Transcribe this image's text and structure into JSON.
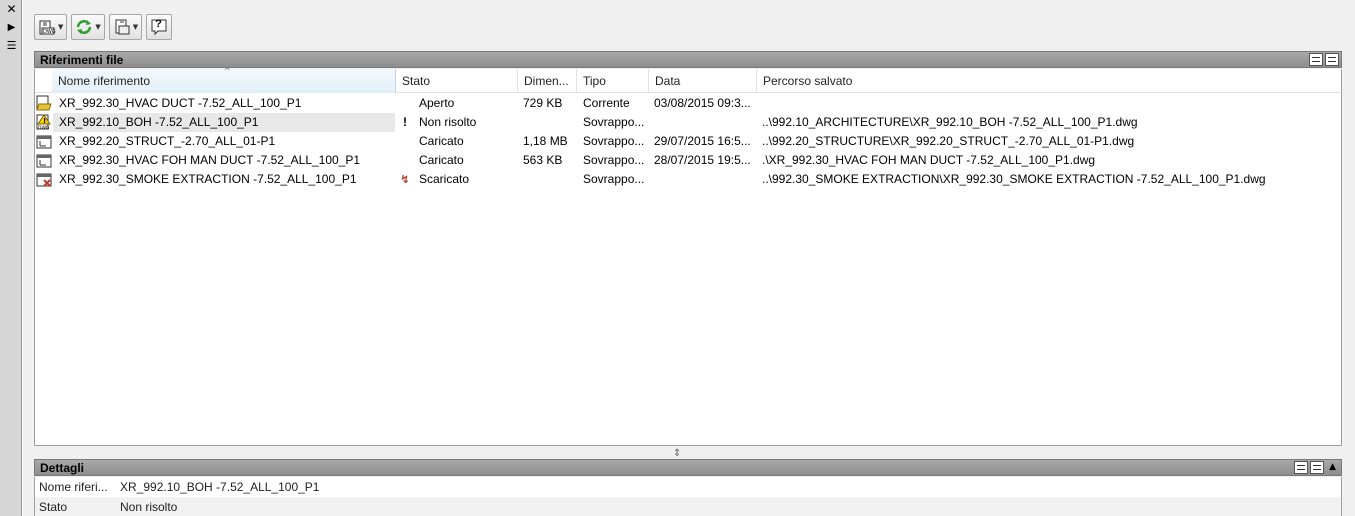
{
  "sidebar": {
    "close_glyph": "✕",
    "autohide_glyph": "▶",
    "properties_glyph": "☰"
  },
  "toolbar": {
    "buttons": [
      {
        "icon": "attach-dwg-icon",
        "has_dropdown": true
      },
      {
        "icon": "refresh-icon",
        "has_dropdown": true
      },
      {
        "icon": "change-path-icon",
        "has_dropdown": true
      },
      {
        "icon": "help-icon",
        "has_dropdown": false
      }
    ],
    "help_glyph": "?"
  },
  "file_references": {
    "title": "Riferimenti file",
    "columns": [
      "Nome riferimento",
      "Stato",
      "Dimen...",
      "Tipo",
      "Data",
      "Percorso salvato"
    ],
    "rows": [
      {
        "icon": "dwg-open-icon",
        "name": "XR_992.30_HVAC DUCT -7.52_ALL_100_P1",
        "mark": "",
        "stato": "Aperto",
        "size": "729 KB",
        "tipo": "Corrente",
        "data": "03/08/2015 09:3...",
        "path": ""
      },
      {
        "icon": "dwg-warning-icon",
        "name": "XR_992.10_BOH -7.52_ALL_100_P1",
        "mark": "!",
        "stato": "Non risolto",
        "size": "",
        "tipo": "Sovrappo...",
        "data": "",
        "path": "..\\992.10_ARCHITECTURE\\XR_992.10_BOH -7.52_ALL_100_P1.dwg"
      },
      {
        "icon": "dwg-loaded-icon",
        "name": "XR_992.20_STRUCT_-2.70_ALL_01-P1",
        "mark": "",
        "stato": "Caricato",
        "size": "1,18 MB",
        "tipo": "Sovrappo...",
        "data": "29/07/2015 16:5...",
        "path": "..\\992.20_STRUCTURE\\XR_992.20_STRUCT_-2.70_ALL_01-P1.dwg"
      },
      {
        "icon": "dwg-loaded-icon",
        "name": "XR_992.30_HVAC FOH MAN DUCT -7.52_ALL_100_P1",
        "mark": "",
        "stato": "Caricato",
        "size": "563 KB",
        "tipo": "Sovrappo...",
        "data": "28/07/2015 19:5...",
        "path": ".\\XR_992.30_HVAC FOH MAN DUCT -7.52_ALL_100_P1.dwg"
      },
      {
        "icon": "dwg-unloaded-icon",
        "name": "XR_992.30_SMOKE EXTRACTION -7.52_ALL_100_P1",
        "mark": "↯",
        "stato": "Scaricato",
        "size": "",
        "tipo": "Sovrappo...",
        "data": "",
        "path": "..\\992.30_SMOKE EXTRACTION\\XR_992.30_SMOKE EXTRACTION -7.52_ALL_100_P1.dwg"
      }
    ],
    "splitter_glyph": "⇕"
  },
  "details": {
    "title": "Dettagli",
    "collapse_glyph": "▲",
    "fields": [
      {
        "label": "Nome riferi...",
        "value": "XR_992.10_BOH -7.52_ALL_100_P1"
      },
      {
        "label": "Stato",
        "value": "Non risolto"
      }
    ]
  },
  "colors": {
    "panel_header": "#9a9a9a",
    "selected_row": "#e8e8e8",
    "unloaded_mark": "#c0392b"
  }
}
